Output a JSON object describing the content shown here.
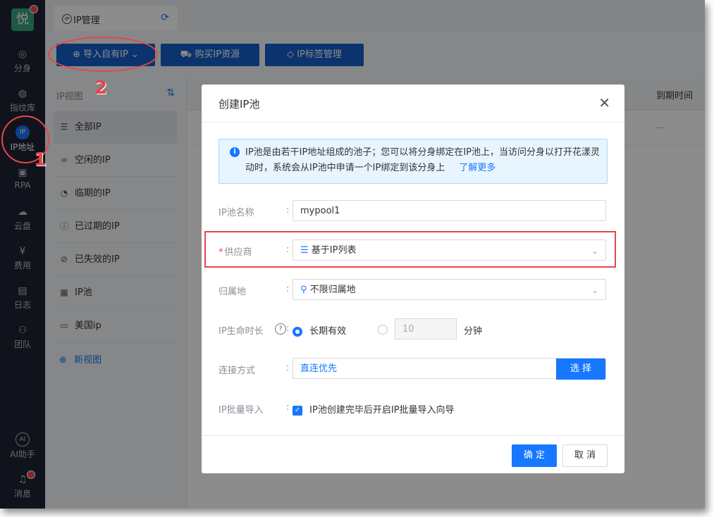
{
  "sidebar": {
    "logo": "悦",
    "items": [
      {
        "label": "分身",
        "icon": "chrome-icon"
      },
      {
        "label": "指纹库",
        "icon": "fingerprint-icon"
      },
      {
        "label": "IP地址",
        "icon": "ip-icon"
      },
      {
        "label": "RPA",
        "icon": "robot-icon"
      },
      {
        "label": "云盘",
        "icon": "cloud-icon"
      },
      {
        "label": "费用",
        "icon": "yen-icon"
      },
      {
        "label": "日志",
        "icon": "document-icon"
      },
      {
        "label": "团队",
        "icon": "team-icon"
      }
    ],
    "ai_label": "AI助手",
    "message_label": "消息"
  },
  "tab": {
    "label": "IP管理"
  },
  "toolbar": {
    "import_label": "导入自有IP",
    "buy_label": "购买IP资源",
    "tag_label": "IP标签管理"
  },
  "views": {
    "title": "IP视图",
    "items": [
      {
        "label": "全部IP",
        "icon": "list-icon"
      },
      {
        "label": "空闲的IP",
        "icon": "link-icon"
      },
      {
        "label": "临期的IP",
        "icon": "clock-icon"
      },
      {
        "label": "已过期的IP",
        "icon": "alert-icon"
      },
      {
        "label": "已失效的IP",
        "icon": "block-icon"
      },
      {
        "label": "IP池",
        "icon": "pool-icon"
      },
      {
        "label": "美国ip",
        "icon": "folder-icon"
      }
    ],
    "new_view": "新视图"
  },
  "table": {
    "col_expire": "到期时间",
    "row_expire": "--"
  },
  "modal": {
    "title": "创建IP池",
    "info_text": "IP池是由若干IP地址组成的池子；您可以将分身绑定在IP池上，当访问分身以打开花漾灵动时，系统会从IP池中申请一个IP绑定到该分身上",
    "info_link": "了解更多",
    "name_label": "IP池名称",
    "name_value": "mypool1",
    "supplier_label": "供应商",
    "supplier_value": "基于IP列表",
    "region_label": "归属地",
    "region_value": "不限归属地",
    "lifetime_label": "IP生命时长",
    "lifetime_option1": "长期有效",
    "lifetime_number": "10",
    "lifetime_unit": "分钟",
    "conn_label": "连接方式",
    "conn_value": "直连优先",
    "conn_button": "选 择",
    "batch_label": "IP批量导入",
    "batch_text": "IP池创建完毕后开启IP批量导入向导",
    "ok": "确 定",
    "cancel": "取 消"
  },
  "annotations": [
    "1",
    "2"
  ],
  "colors": {
    "primary": "#1677ff",
    "annotation": "#e5474b",
    "sidebar": "#1f2433"
  }
}
